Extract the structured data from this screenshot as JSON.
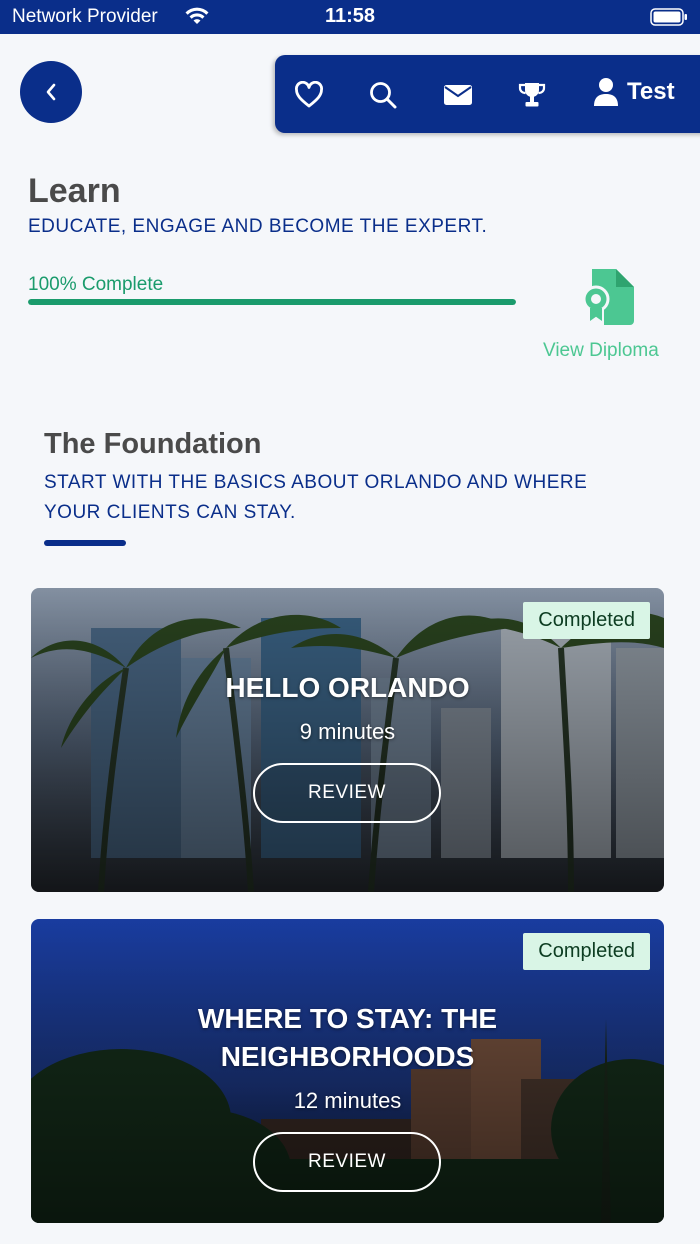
{
  "status_bar": {
    "carrier": "Network Provider",
    "time": "11:58"
  },
  "nav": {
    "user_label": "Test",
    "icons": [
      "heart-icon",
      "search-icon",
      "mail-icon",
      "trophy-icon",
      "user-icon"
    ]
  },
  "learn": {
    "title": "Learn",
    "subtitle": "EDUCATE, ENGAGE AND BECOME THE EXPERT.",
    "progress_label": "100% Complete",
    "progress_value": 1.0,
    "diploma_label": "View Diploma"
  },
  "section": {
    "title": "The Foundation",
    "subtitle": "START WITH THE BASICS ABOUT ORLANDO AND WHERE YOUR CLIENTS CAN STAY."
  },
  "lessons": [
    {
      "badge": "Completed",
      "title": "HELLO ORLANDO",
      "duration": "9 minutes",
      "button": "REVIEW"
    },
    {
      "badge": "Completed",
      "title": "WHERE TO STAY: THE NEIGHBORHOODS",
      "duration": "12 minutes",
      "button": "REVIEW"
    }
  ],
  "colors": {
    "primary": "#0a2e8a",
    "success": "#1a9b6c",
    "diploma": "#4cc792",
    "badge_bg": "#d9f5e6"
  }
}
